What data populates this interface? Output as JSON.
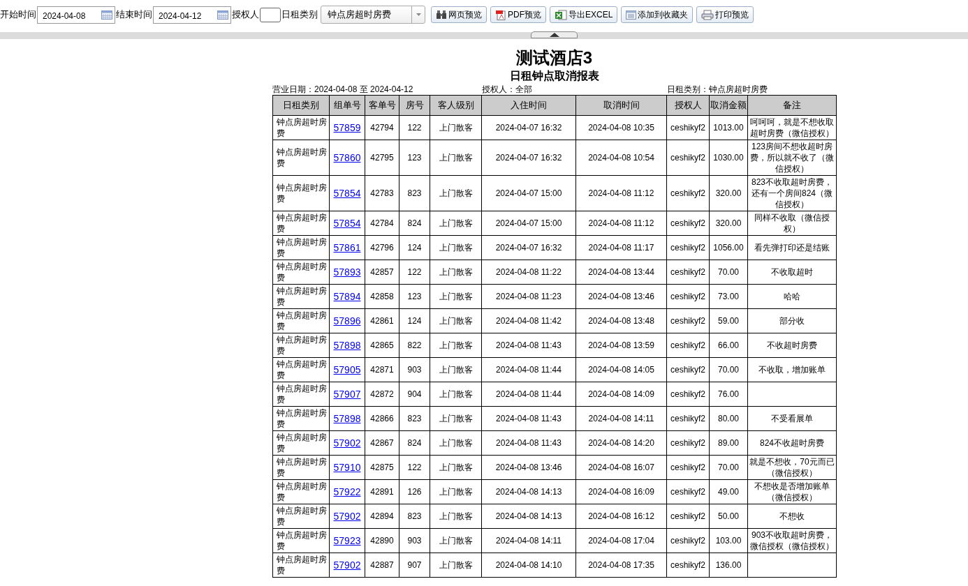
{
  "toolbar": {
    "start_label": "开始时间",
    "start_value": "2024-04-08",
    "end_label": "结束时间",
    "end_value": "2024-04-12",
    "authorizer_label": "授权人",
    "category_label": "日租类别",
    "category_value": "钟点房超时房费",
    "buttons": [
      {
        "kind": "web",
        "label": "网页预览"
      },
      {
        "kind": "pdf",
        "label": "PDF预览"
      },
      {
        "kind": "excel",
        "label": "导出EXCEL"
      },
      {
        "kind": "favorite",
        "label": "添加到收藏夹"
      },
      {
        "kind": "print",
        "label": "打印预览"
      }
    ]
  },
  "report": {
    "title": "测试酒店3",
    "subtitle": "日租钟点取消报表",
    "business_date": "营业日期：2024-04-08 至 2024-04-12",
    "authorizer": "授权人：全部",
    "category": "日租类别：钟点房超时房费"
  },
  "table": {
    "columns": [
      "日租类别",
      "组单号",
      "客单号",
      "房号",
      "客人级别",
      "入住时间",
      "取消时间",
      "授权人",
      "取消金额",
      "备注"
    ],
    "rows": [
      {
        "category": "钟点房超时房费",
        "group_no": "57859",
        "guest_no": "42794",
        "room": "122",
        "level": "上门散客",
        "checkin": "2024-04-07 16:32",
        "cancel": "2024-04-08 10:35",
        "authorizer": "ceshikyf2",
        "amount": "1013.00",
        "remark": "呵呵呵，就是不想收取超时房费（微信授权）"
      },
      {
        "category": "钟点房超时房费",
        "group_no": "57860",
        "guest_no": "42795",
        "room": "123",
        "level": "上门散客",
        "checkin": "2024-04-07 16:32",
        "cancel": "2024-04-08 10:54",
        "authorizer": "ceshikyf2",
        "amount": "1030.00",
        "remark": "123房间不想收超时房费，所以就不收了（微信授权）"
      },
      {
        "category": "钟点房超时房费",
        "group_no": "57854",
        "guest_no": "42783",
        "room": "823",
        "level": "上门散客",
        "checkin": "2024-04-07 15:00",
        "cancel": "2024-04-08 11:12",
        "authorizer": "ceshikyf2",
        "amount": "320.00",
        "remark": "823不收取超时房费，还有一个房间824（微信授权）"
      },
      {
        "category": "钟点房超时房费",
        "group_no": "57854",
        "guest_no": "42784",
        "room": "824",
        "level": "上门散客",
        "checkin": "2024-04-07 15:00",
        "cancel": "2024-04-08 11:12",
        "authorizer": "ceshikyf2",
        "amount": "320.00",
        "remark": "同样不收取（微信授权）"
      },
      {
        "category": "钟点房超时房费",
        "group_no": "57861",
        "guest_no": "42796",
        "room": "124",
        "level": "上门散客",
        "checkin": "2024-04-07 16:32",
        "cancel": "2024-04-08 11:17",
        "authorizer": "ceshikyf2",
        "amount": "1056.00",
        "remark": "看先弹打印还是结账"
      },
      {
        "category": "钟点房超时房费",
        "group_no": "57893",
        "guest_no": "42857",
        "room": "122",
        "level": "上门散客",
        "checkin": "2024-04-08 11:22",
        "cancel": "2024-04-08 13:44",
        "authorizer": "ceshikyf2",
        "amount": "70.00",
        "remark": "不收取超时"
      },
      {
        "category": "钟点房超时房费",
        "group_no": "57894",
        "guest_no": "42858",
        "room": "123",
        "level": "上门散客",
        "checkin": "2024-04-08 11:23",
        "cancel": "2024-04-08 13:46",
        "authorizer": "ceshikyf2",
        "amount": "73.00",
        "remark": "哈哈"
      },
      {
        "category": "钟点房超时房费",
        "group_no": "57896",
        "guest_no": "42861",
        "room": "124",
        "level": "上门散客",
        "checkin": "2024-04-08 11:42",
        "cancel": "2024-04-08 13:48",
        "authorizer": "ceshikyf2",
        "amount": "59.00",
        "remark": "部分收"
      },
      {
        "category": "钟点房超时房费",
        "group_no": "57898",
        "guest_no": "42865",
        "room": "822",
        "level": "上门散客",
        "checkin": "2024-04-08 11:43",
        "cancel": "2024-04-08 13:59",
        "authorizer": "ceshikyf2",
        "amount": "66.00",
        "remark": "不收超时房费"
      },
      {
        "category": "钟点房超时房费",
        "group_no": "57905",
        "guest_no": "42871",
        "room": "903",
        "level": "上门散客",
        "checkin": "2024-04-08 11:44",
        "cancel": "2024-04-08 14:05",
        "authorizer": "ceshikyf2",
        "amount": "70.00",
        "remark": "不收取，增加账单"
      },
      {
        "category": "钟点房超时房费",
        "group_no": "57907",
        "guest_no": "42872",
        "room": "904",
        "level": "上门散客",
        "checkin": "2024-04-08 11:44",
        "cancel": "2024-04-08 14:09",
        "authorizer": "ceshikyf2",
        "amount": "76.00"
      },
      {
        "category": "钟点房超时房费",
        "group_no": "57898",
        "guest_no": "42866",
        "room": "823",
        "level": "上门散客",
        "checkin": "2024-04-08 11:43",
        "cancel": "2024-04-08 14:11",
        "authorizer": "ceshikyf2",
        "amount": "80.00",
        "remark": "不受看展单"
      },
      {
        "category": "钟点房超时房费",
        "group_no": "57902",
        "guest_no": "42867",
        "room": "824",
        "level": "上门散客",
        "checkin": "2024-04-08 11:43",
        "cancel": "2024-04-08 14:20",
        "authorizer": "ceshikyf2",
        "amount": "89.00",
        "remark": "824不收超时房费"
      },
      {
        "category": "钟点房超时房费",
        "group_no": "57910",
        "guest_no": "42875",
        "room": "122",
        "level": "上门散客",
        "checkin": "2024-04-08 13:46",
        "cancel": "2024-04-08 16:07",
        "authorizer": "ceshikyf2",
        "amount": "70.00",
        "remark": "就是不想收，70元而已（微信授权）"
      },
      {
        "category": "钟点房超时房费",
        "group_no": "57922",
        "guest_no": "42891",
        "room": "126",
        "level": "上门散客",
        "checkin": "2024-04-08 14:13",
        "cancel": "2024-04-08 16:09",
        "authorizer": "ceshikyf2",
        "amount": "49.00",
        "remark": "不想收是否增加账单（微信授权）"
      },
      {
        "category": "钟点房超时房费",
        "group_no": "57902",
        "guest_no": "42894",
        "room": "823",
        "level": "上门散客",
        "checkin": "2024-04-08 14:13",
        "cancel": "2024-04-08 16:12",
        "authorizer": "ceshikyf2",
        "amount": "50.00",
        "remark": "不想收"
      },
      {
        "category": "钟点房超时房费",
        "group_no": "57923",
        "guest_no": "42890",
        "room": "903",
        "level": "上门散客",
        "checkin": "2024-04-08 14:11",
        "cancel": "2024-04-08 17:04",
        "authorizer": "ceshikyf2",
        "amount": "103.00",
        "remark": "903不收取超时房费，微信授权（微信授权）"
      },
      {
        "category": "钟点房超时房费",
        "group_no": "57902",
        "guest_no": "42887",
        "room": "907",
        "level": "上门散客",
        "checkin": "2024-04-08 14:10",
        "cancel": "2024-04-08 17:35",
        "authorizer": "ceshikyf2",
        "amount": "136.00"
      }
    ]
  }
}
